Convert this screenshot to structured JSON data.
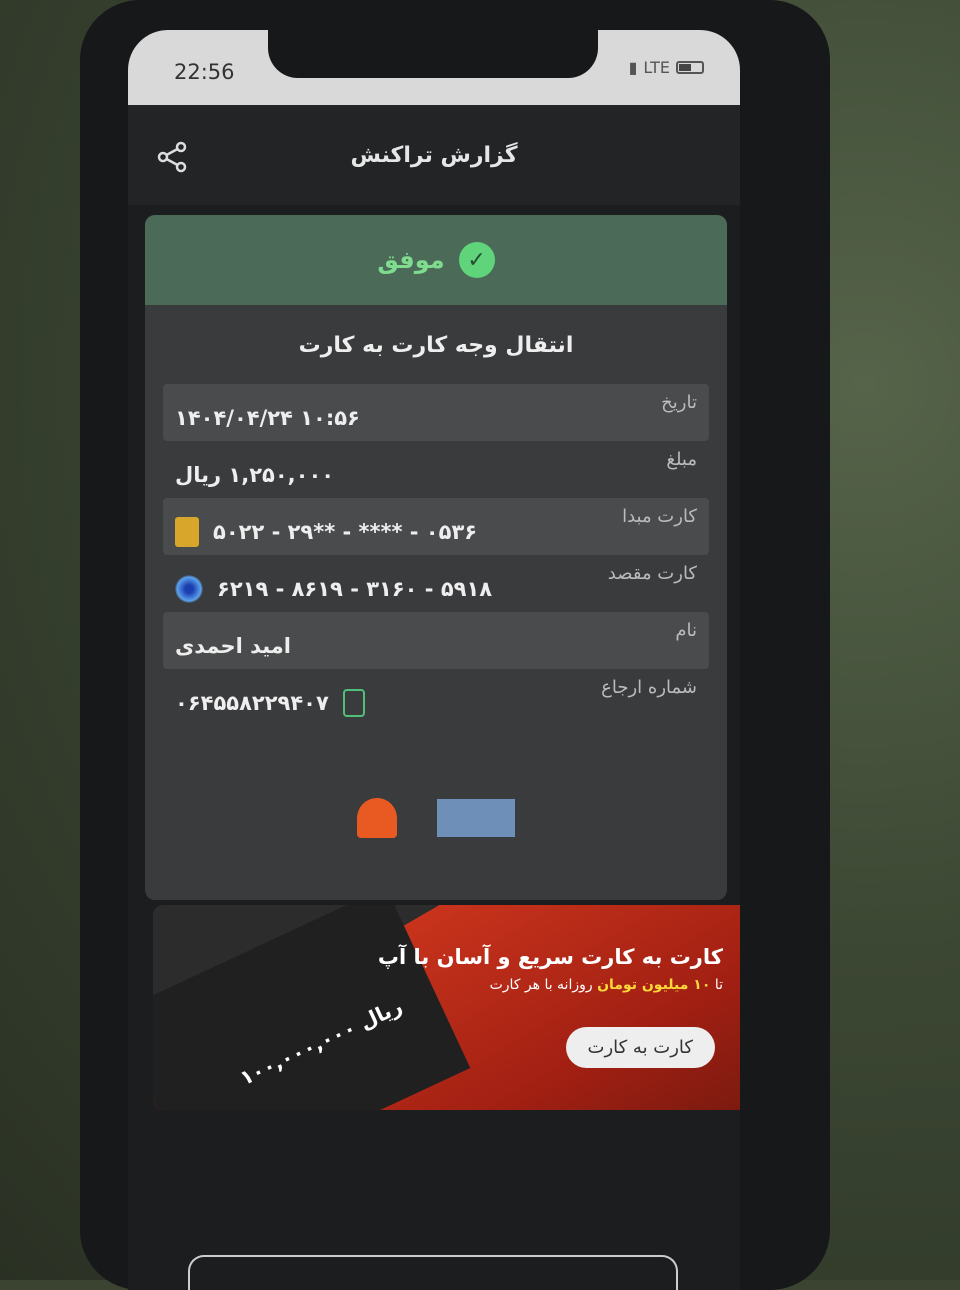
{
  "status_bar": {
    "time": "22:56",
    "network": "LTE"
  },
  "header": {
    "title": "گزارش تراکنش",
    "share_icon": "share-icon"
  },
  "result": {
    "status": "موفق",
    "status_color": "#5fd47a"
  },
  "transaction": {
    "title": "انتقال وجه کارت به کارت",
    "rows": [
      {
        "label": "تاریخ",
        "value": "۱۴۰۴/۰۴/۲۴ ۱۰:۵۶"
      },
      {
        "label": "مبلغ",
        "value": "۱,۲۵۰,۰۰۰ ریال"
      },
      {
        "label": "کارت مبدا",
        "value": "۵۰۲۲ - ۲۹** - **** - ۰۵۳۶"
      },
      {
        "label": "کارت مقصد",
        "value": "۶۲۱۹ - ۸۶۱۹ - ۳۱۶۰ - ۵۹۱۸"
      },
      {
        "label": "نام",
        "value": "امید احمدی"
      },
      {
        "label": "شماره ارجاع",
        "value": "۰۶۴۵۵۸۲۲۹۴۰۷"
      }
    ]
  },
  "banner": {
    "heading": "کارت به کارت سریع و آسان با آپ",
    "sub_prefix": "تا ",
    "sub_highlight": "۱۰ میلیون تومان",
    "sub_suffix": " روزانه با هر کارت",
    "image_amount": "۱۰۰,۰۰۰,۰۰۰ ریال",
    "button": "کارت به کارت"
  }
}
